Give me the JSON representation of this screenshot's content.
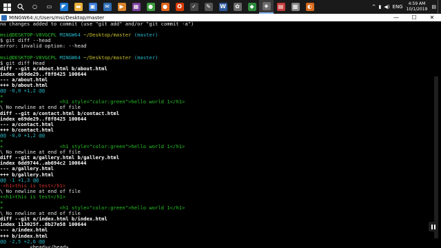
{
  "taskbar": {
    "start_icon": "windows-logo-icon",
    "search_icon": "search-icon",
    "apps": [
      {
        "name": "cortana-icon",
        "glyph": "○",
        "color": "#1a1a1a"
      },
      {
        "name": "task-view-icon",
        "glyph": "▭",
        "color": "#1a1a1a"
      },
      {
        "name": "vscode-icon",
        "glyph": "◤",
        "color": "#1e7bd6"
      },
      {
        "name": "file-explorer-icon",
        "glyph": "▬",
        "color": "#e8b13a"
      },
      {
        "name": "store-icon",
        "glyph": "▣",
        "color": "#3a7bd5"
      },
      {
        "name": "mail-icon",
        "glyph": "✉",
        "color": "#2d6db5"
      },
      {
        "name": "media-player-icon",
        "glyph": "▶",
        "color": "#d9822b"
      },
      {
        "name": "winrar-icon",
        "glyph": "▦",
        "color": "#7b3f9a"
      },
      {
        "name": "chrome-icon",
        "glyph": "●",
        "color": "#3c9b3f"
      },
      {
        "name": "firefox-icon",
        "glyph": "●",
        "color": "#e0641b"
      },
      {
        "name": "office-icon",
        "glyph": "O",
        "color": "#d83b01"
      },
      {
        "name": "app-icon",
        "glyph": "✓",
        "color": "#444444"
      },
      {
        "name": "app-icon-2",
        "glyph": "✎",
        "color": "#555555"
      },
      {
        "name": "word-icon",
        "glyph": "W",
        "color": "#2b579a"
      },
      {
        "name": "paint-icon",
        "glyph": "✿",
        "color": "#6a6a6a"
      },
      {
        "name": "photos-icon",
        "glyph": "◆",
        "color": "#2c8a3c"
      },
      {
        "name": "git-bash-icon",
        "glyph": "◈",
        "color": "#6a6a6a"
      },
      {
        "name": "app-icon-3",
        "glyph": "▤",
        "color": "#c43a3a"
      },
      {
        "name": "app-icon-4",
        "glyph": "▩",
        "color": "#888888"
      },
      {
        "name": "app-icon-5",
        "glyph": "◐",
        "color": "#d66a1a"
      }
    ],
    "active_app_index": 16,
    "tray": {
      "chevron": "^",
      "language": "ENG",
      "time": "4:59 AM",
      "date": "10/1/2019",
      "notification_icon": "notification-icon"
    }
  },
  "window": {
    "title": "MINGW64:/c/Users/msi/Desktop/master",
    "controls": {
      "minimize": "—",
      "maximize": "☐",
      "close": "✕"
    }
  },
  "terminal": {
    "lines": [
      [
        [
          "no changes added to commit (use \"git add\" and/or \"git commit -a\")",
          "c-plain"
        ]
      ],
      [
        [
          "",
          "c-plain"
        ]
      ],
      [
        [
          "msi@DESKTOP-V8VGCPL",
          "prompt-user"
        ],
        [
          " MINGW64",
          "prompt-branch"
        ],
        [
          " ~/Desktop/master",
          "prompt-path"
        ],
        [
          " (master)",
          "prompt-branch"
        ]
      ],
      [
        [
          "$ git diff --head",
          "c-plain"
        ]
      ],
      [
        [
          "error: invalid option: --head",
          "c-plain"
        ]
      ],
      [
        [
          "",
          "c-plain"
        ]
      ],
      [
        [
          "msi@DESKTOP-V8VGCPL",
          "prompt-user"
        ],
        [
          " MINGW64",
          "prompt-branch"
        ],
        [
          " ~/Desktop/master",
          "prompt-path"
        ],
        [
          " (master)",
          "prompt-branch"
        ]
      ],
      [
        [
          "$ git diff Head",
          "c-plain"
        ]
      ],
      [
        [
          "diff --git a/about.html b/about.html",
          "c-bold"
        ]
      ],
      [
        [
          "index e69de29..f8f8425 100644",
          "c-bold"
        ]
      ],
      [
        [
          "--- a/about.html",
          "c-bold"
        ]
      ],
      [
        [
          "+++ b/about.html",
          "c-bold"
        ]
      ],
      [
        [
          "@@ -0,0 +1,2 @@",
          "c-meta"
        ]
      ],
      [
        [
          "+",
          "c-add"
        ]
      ],
      [
        [
          "+                   <h1 style=\"color:green\">hello world 1</h1>",
          "c-add"
        ]
      ],
      [
        [
          "\\ No newline at end of file",
          "c-plain"
        ]
      ],
      [
        [
          "diff --git a/contact.html b/contact.html",
          "c-bold"
        ]
      ],
      [
        [
          "index e69de29..f8f8425 100644",
          "c-bold"
        ]
      ],
      [
        [
          "--- a/contact.html",
          "c-bold"
        ]
      ],
      [
        [
          "+++ b/contact.html",
          "c-bold"
        ]
      ],
      [
        [
          "@@ -0,0 +1,2 @@",
          "c-meta"
        ]
      ],
      [
        [
          "+",
          "c-add"
        ]
      ],
      [
        [
          "+                   <h1 style=\"color:green\">hello world 1</h1>",
          "c-add"
        ]
      ],
      [
        [
          "\\ No newline at end of file",
          "c-plain"
        ]
      ],
      [
        [
          "diff --git a/gallery.html b/gallery.html",
          "c-bold"
        ]
      ],
      [
        [
          "index 6dd9744..ab694c2 100644",
          "c-bold"
        ]
      ],
      [
        [
          "--- a/gallery.html",
          "c-bold"
        ]
      ],
      [
        [
          "+++ b/gallery.html",
          "c-bold"
        ]
      ],
      [
        [
          "@@ -1 +1,3 @@",
          "c-meta"
        ]
      ],
      [
        [
          "-<h1>this is test</h1>",
          "c-del"
        ]
      ],
      [
        [
          "\\ No newline at end of file",
          "c-plain"
        ]
      ],
      [
        [
          "+<h1>this is test</h1>",
          "c-add"
        ]
      ],
      [
        [
          "+",
          "c-add"
        ]
      ],
      [
        [
          "+                   <h1 style=\"color:green\">hello world 1</h1>",
          "c-add"
        ]
      ],
      [
        [
          "\\ No newline at end of file",
          "c-plain"
        ]
      ],
      [
        [
          "diff --git a/index.html b/index.html",
          "c-bold"
        ]
      ],
      [
        [
          "index 113025f..8b27e58 100644",
          "c-bold"
        ]
      ],
      [
        [
          "--- a/index.html",
          "c-bold"
        ]
      ],
      [
        [
          "+++ b/index.html",
          "c-bold"
        ]
      ],
      [
        [
          "@@ -2,5 +2,6 @@",
          "c-meta"
        ]
      ],
      [
        [
          "          <head></head>",
          "c-plain"
        ]
      ]
    ]
  }
}
